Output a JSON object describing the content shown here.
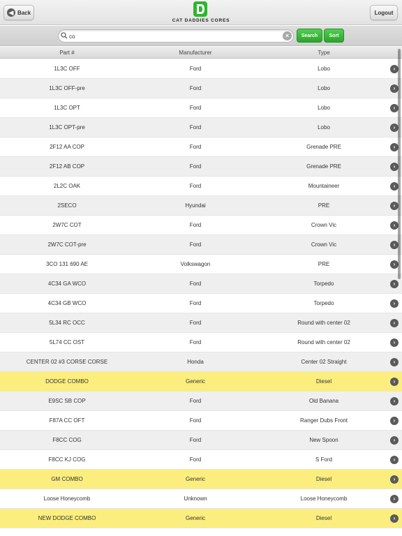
{
  "header": {
    "back_label": "Back",
    "logo_letter": "D",
    "logo_text": "CAT DADDIES CORES",
    "logout_label": "Logout"
  },
  "search": {
    "value": "co",
    "search_label": "Search",
    "sort_label": "Sort"
  },
  "columns": {
    "part": "Part #",
    "manufacturer": "Manufacturer",
    "type": "Type"
  },
  "colors": {
    "accent_green": "#2fb52f",
    "highlight_yellow": "#fbee7e",
    "row_alt": "#efefef"
  },
  "rows": [
    {
      "part": "1L3C OFF",
      "manufacturer": "Ford",
      "type": "Lobo",
      "highlight": false
    },
    {
      "part": "1L3C OFF-pre",
      "manufacturer": "Ford",
      "type": "Lobo",
      "highlight": false
    },
    {
      "part": "1L3C OPT",
      "manufacturer": "Ford",
      "type": "Lobo",
      "highlight": false
    },
    {
      "part": "1L3C OPT-pre",
      "manufacturer": "Ford",
      "type": "Lobo",
      "highlight": false
    },
    {
      "part": "2F12 AA COP",
      "manufacturer": "Ford",
      "type": "Grenade PRE",
      "highlight": false
    },
    {
      "part": "2F12 AB COP",
      "manufacturer": "Ford",
      "type": "Grenade PRE",
      "highlight": false
    },
    {
      "part": "2L2C OAK",
      "manufacturer": "Ford",
      "type": "Mountaineer",
      "highlight": false
    },
    {
      "part": "2SECO",
      "manufacturer": "Hyundai",
      "type": "PRE",
      "highlight": false
    },
    {
      "part": "2W7C COT",
      "manufacturer": "Ford",
      "type": "Crown Vic",
      "highlight": false
    },
    {
      "part": "2W7C COT-pre",
      "manufacturer": "Ford",
      "type": "Crown Vic",
      "highlight": false
    },
    {
      "part": "3CO 131 690 AE",
      "manufacturer": "Volkswagon",
      "type": "PRE",
      "highlight": false
    },
    {
      "part": "4C34 GA WCO",
      "manufacturer": "Ford",
      "type": "Torpedo",
      "highlight": false
    },
    {
      "part": "4C34 GB WCO",
      "manufacturer": "Ford",
      "type": "Torpedo",
      "highlight": false
    },
    {
      "part": "5L34 RC OCC",
      "manufacturer": "Ford",
      "type": "Round with center 02",
      "highlight": false
    },
    {
      "part": "5L74 CC OST",
      "manufacturer": "Ford",
      "type": "Round with center 02",
      "highlight": false
    },
    {
      "part": "CENTER 02 #3 CORSE CORSE",
      "manufacturer": "Honda",
      "type": "Center 02 Straight",
      "highlight": false
    },
    {
      "part": "DODGE COMBO",
      "manufacturer": "Generic",
      "type": "Diesel",
      "highlight": true
    },
    {
      "part": "E9SC SB COP",
      "manufacturer": "Ford",
      "type": "Old Banana",
      "highlight": false
    },
    {
      "part": "F87A CC OFT",
      "manufacturer": "Ford",
      "type": "Ranger Dubs Front",
      "highlight": false
    },
    {
      "part": "F8CC COG",
      "manufacturer": "Ford",
      "type": "New Spoon",
      "highlight": false
    },
    {
      "part": "F8CC KJ COG",
      "manufacturer": "Ford",
      "type": "S Ford",
      "highlight": false
    },
    {
      "part": "GM COMBO",
      "manufacturer": "Generic",
      "type": "Diesel",
      "highlight": true
    },
    {
      "part": "Loose Honeycomb",
      "manufacturer": "Unknown",
      "type": "Loose Honeycomb",
      "highlight": false
    },
    {
      "part": "NEW DODGE COMBO",
      "manufacturer": "Generic",
      "type": "Diesel",
      "highlight": true
    }
  ]
}
